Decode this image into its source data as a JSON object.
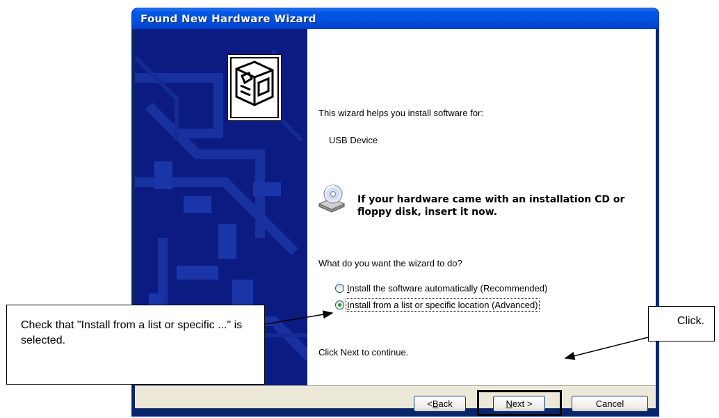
{
  "window": {
    "title": "Found New Hardware Wizard"
  },
  "content": {
    "intro": "This wizard helps you install software for:",
    "device_name": "USB Device",
    "cd_prompt": "If your hardware came with an installation CD or floppy disk, insert it now.",
    "question": "What do you want the wizard to do?",
    "options": [
      {
        "label": "Install the software automatically (Recommended)",
        "accel": "I",
        "selected": false
      },
      {
        "label": "Install from a list or specific location (Advanced)",
        "accel": "I",
        "selected": true
      }
    ],
    "continue_hint": "Click Next to continue."
  },
  "buttons": {
    "back": {
      "prefix": "< ",
      "accel": "B",
      "rest": "ack"
    },
    "next": {
      "prefix": "",
      "accel": "N",
      "rest": "ext >"
    },
    "cancel": "Cancel"
  },
  "annotations": {
    "left_callout": "Check that \"Install from a list or specific ...\" is selected.",
    "right_callout": "Click."
  },
  "colors": {
    "titlebar": "#0058e6",
    "left_panel": "#0b1a80",
    "radio_dot": "#21a121"
  },
  "icons": [
    "hardware-device-icon",
    "cd-drive-icon",
    "radio-unchecked-icon",
    "radio-checked-icon"
  ]
}
